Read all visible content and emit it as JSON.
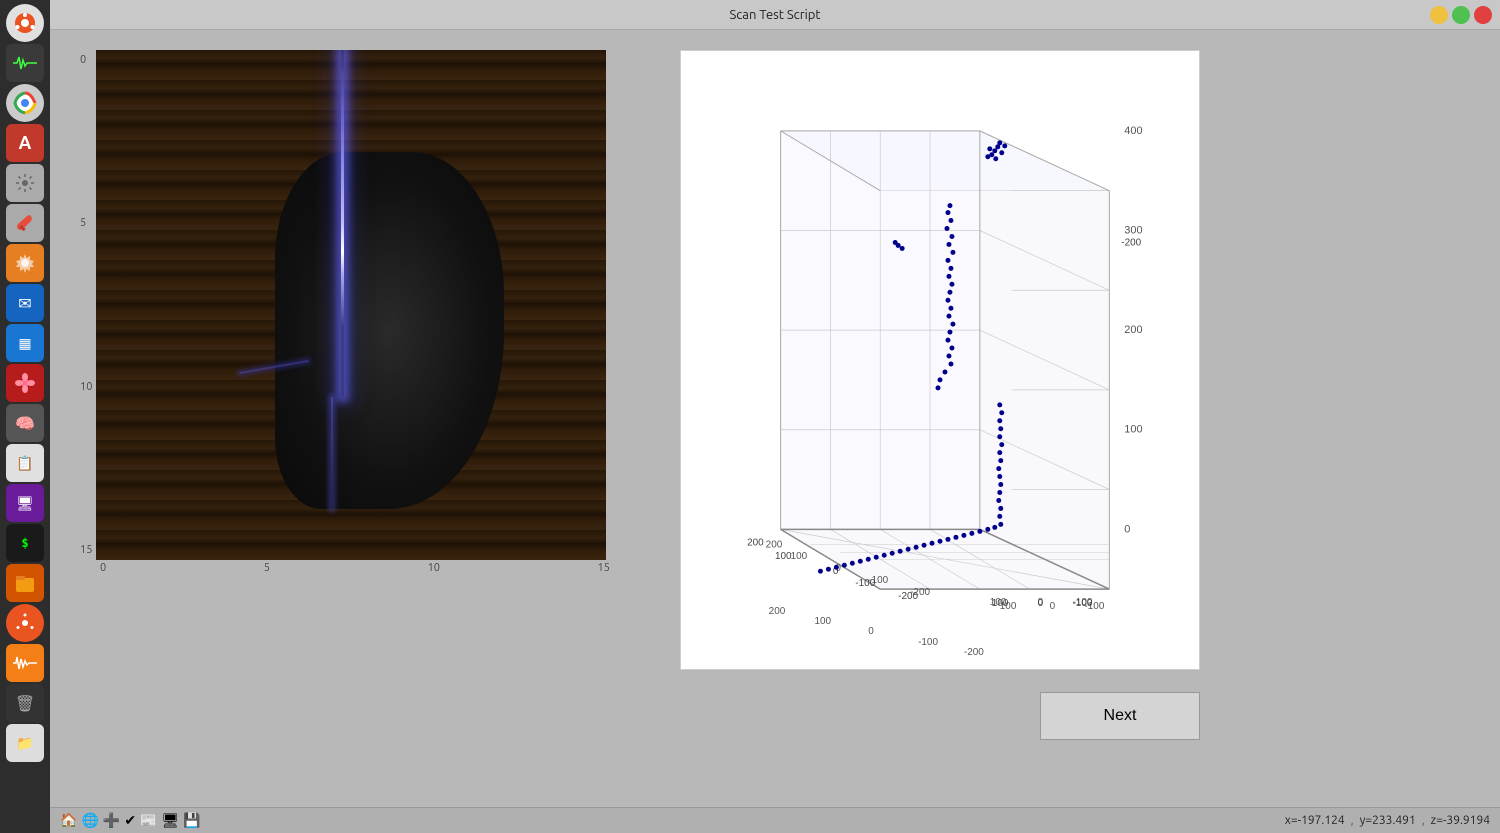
{
  "window": {
    "title": "Scan Test Script"
  },
  "sidebar": {
    "icons": [
      {
        "name": "home-icon",
        "symbol": "⌂",
        "bg": "#e0e0e0",
        "border_radius": "50%"
      },
      {
        "name": "monitor-icon",
        "symbol": "📊",
        "bg": "#4a7c4e"
      },
      {
        "name": "chrome-icon",
        "symbol": "◎",
        "bg": "#ccc"
      },
      {
        "name": "font-icon",
        "symbol": "A",
        "bg": "#e74c3c"
      },
      {
        "name": "tools-icon",
        "symbol": "⚙",
        "bg": "#bdbdbd"
      },
      {
        "name": "wrench-icon",
        "symbol": "🔧",
        "bg": "#bdbdbd"
      },
      {
        "name": "gear-icon",
        "symbol": "⚙",
        "bg": "#ff6f00"
      },
      {
        "name": "msg-icon",
        "symbol": "✉",
        "bg": "#1565c0"
      },
      {
        "name": "table-icon",
        "symbol": "▦",
        "bg": "#1976d2"
      },
      {
        "name": "red-icon",
        "symbol": "🌸",
        "bg": "#c62828"
      },
      {
        "name": "brain-icon",
        "symbol": "🧠",
        "bg": "#616161"
      },
      {
        "name": "docs-icon",
        "symbol": "📄",
        "bg": "#e0e0e0"
      },
      {
        "name": "monitor2-icon",
        "symbol": "🖥",
        "bg": "#7b1fa2"
      },
      {
        "name": "terminal-icon",
        "symbol": ">_",
        "bg": "#1a1a1a"
      },
      {
        "name": "folder-icon",
        "symbol": "📁",
        "bg": "#e65100"
      },
      {
        "name": "ubuntu-icon",
        "symbol": "◉",
        "bg": "#e95420"
      },
      {
        "name": "wave-icon",
        "symbol": "〰",
        "bg": "#ff8f00"
      },
      {
        "name": "dark-icon",
        "symbol": "■",
        "bg": "#212121"
      },
      {
        "name": "files-icon",
        "symbol": "📋",
        "bg": "#e0e0e0"
      }
    ]
  },
  "camera_plot": {
    "x_labels": [
      "0",
      "5",
      "10",
      "15"
    ],
    "y_labels": [
      "0",
      "5",
      "10",
      "15"
    ]
  },
  "scatter_plot": {
    "title": "",
    "y_axis": {
      "max": 400,
      "ticks": [
        "400",
        "300",
        "200",
        "100",
        "0"
      ]
    },
    "x_axis": {
      "ticks": [
        "-200",
        "-100",
        "0",
        "100",
        "200"
      ]
    },
    "z_axis": {
      "ticks": [
        "-200",
        "-100",
        "0"
      ]
    }
  },
  "buttons": {
    "next_label": "Next"
  },
  "statusbar": {
    "x_coord": "x=-197.124",
    "y_coord": "y=233.491",
    "z_coord": "z=-39.9194"
  },
  "taskbar": {
    "icons": [
      "🏠",
      "🌐",
      "➕",
      "✔",
      "📰",
      "🖥",
      "💾"
    ]
  }
}
